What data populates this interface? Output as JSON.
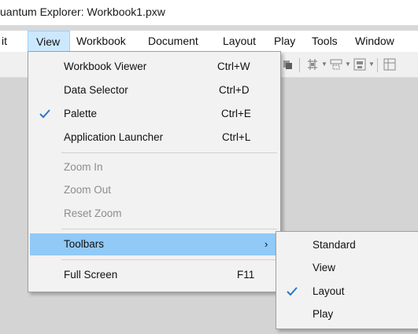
{
  "window": {
    "title": "uantum Explorer: Workbook1.pxw"
  },
  "menubar": {
    "items": [
      {
        "label": "it"
      },
      {
        "label": "View"
      },
      {
        "label": "Workbook"
      },
      {
        "label": "Document"
      },
      {
        "label": "Layout"
      },
      {
        "label": "Play"
      },
      {
        "label": "Tools"
      },
      {
        "label": "Window"
      }
    ]
  },
  "view_menu": {
    "items": [
      {
        "label": "Workbook Viewer",
        "shortcut": "Ctrl+W"
      },
      {
        "label": "Data Selector",
        "shortcut": "Ctrl+D"
      },
      {
        "label": "Palette",
        "shortcut": "Ctrl+E",
        "checked": true
      },
      {
        "label": "Application Launcher",
        "shortcut": "Ctrl+L"
      },
      {
        "label": "Zoom In",
        "disabled": true
      },
      {
        "label": "Zoom Out",
        "disabled": true
      },
      {
        "label": "Reset Zoom",
        "disabled": true
      },
      {
        "label": "Toolbars",
        "submenu_arrow": "›",
        "highlighted": true
      },
      {
        "label": "Full Screen",
        "shortcut": "F11"
      }
    ]
  },
  "toolbars_submenu": {
    "items": [
      {
        "label": "Standard"
      },
      {
        "label": "View"
      },
      {
        "label": "Layout",
        "checked": true
      },
      {
        "label": "Play"
      }
    ]
  },
  "icons": {
    "check": "check-icon",
    "submenu_arrow": "chevron-right-icon"
  },
  "colors": {
    "menu_bg": "#f2f2f2",
    "highlight": "#91c9f7",
    "active_menu": "#cce8ff",
    "check": "#2b78c5",
    "workspace": "#d4d4d4"
  }
}
